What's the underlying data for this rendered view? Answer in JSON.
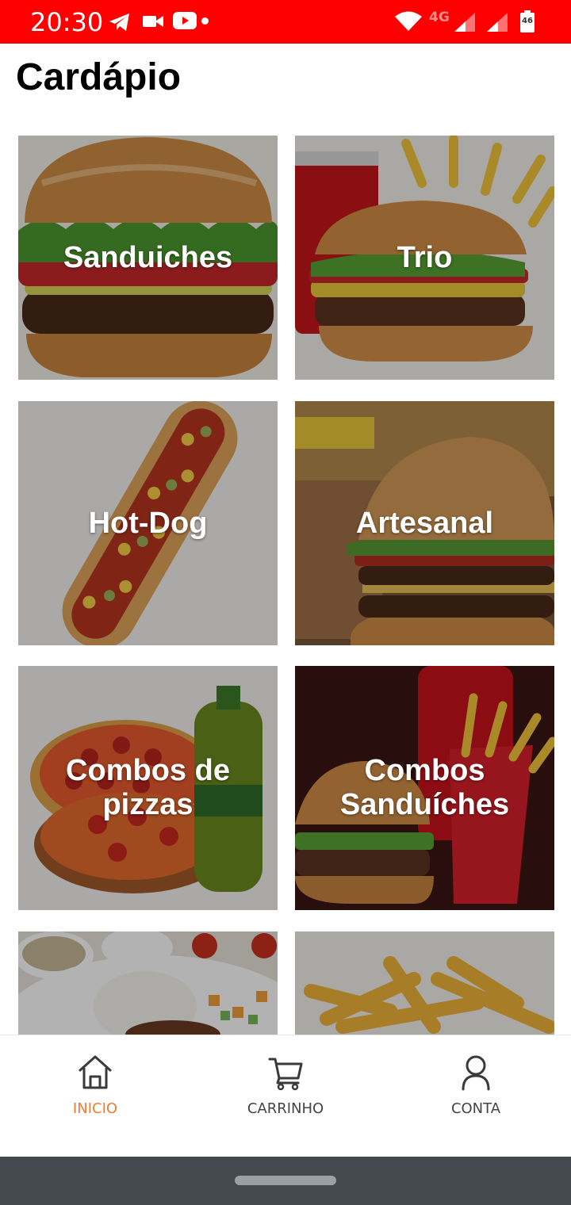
{
  "status_bar": {
    "time": "20:30",
    "network_label": "4G",
    "battery_label": "46",
    "color": "#ff0000",
    "icons": [
      "telegram-icon",
      "video-camera-icon",
      "youtube-icon",
      "notification-dot-icon",
      "wifi-icon",
      "signal-icon",
      "signal-icon",
      "battery-icon"
    ]
  },
  "page": {
    "title": "Cardápio"
  },
  "categories": [
    {
      "label": "Sanduiches"
    },
    {
      "label": "Trio"
    },
    {
      "label": "Hot-Dog"
    },
    {
      "label": "Artesanal"
    },
    {
      "label": "Combos de pizzas"
    },
    {
      "label": "Combos Sanduíches"
    },
    {
      "label": ""
    },
    {
      "label": ""
    }
  ],
  "bottom_nav": {
    "active_color": "#f27b2f",
    "items": [
      {
        "label": "INICIO",
        "icon": "home-icon",
        "active": true
      },
      {
        "label": "CARRINHO",
        "icon": "cart-icon",
        "active": false
      },
      {
        "label": "CONTA",
        "icon": "user-icon",
        "active": false
      }
    ]
  }
}
